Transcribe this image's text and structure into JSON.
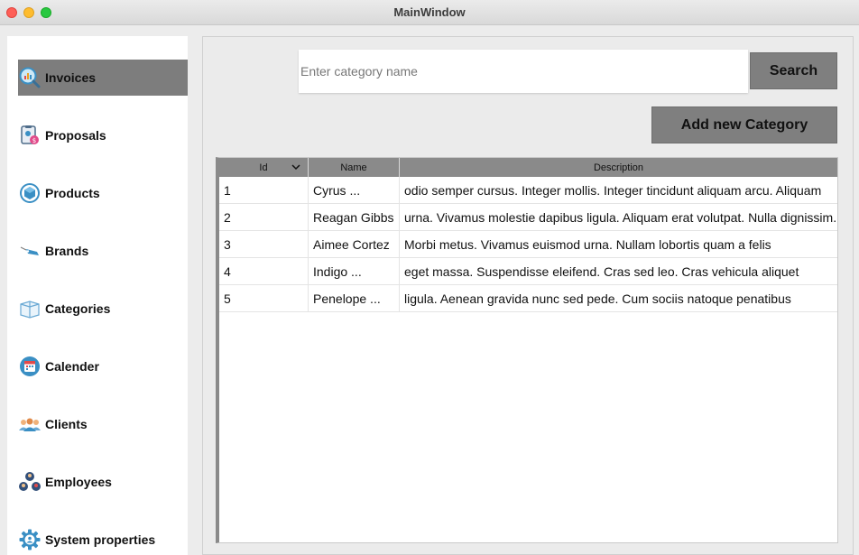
{
  "window": {
    "title": "MainWindow"
  },
  "sidebar": {
    "items": [
      {
        "label": "Invoices",
        "icon": "invoices-icon",
        "active": true
      },
      {
        "label": "Proposals",
        "icon": "proposals-icon",
        "active": false
      },
      {
        "label": "Products",
        "icon": "products-icon",
        "active": false
      },
      {
        "label": "Brands",
        "icon": "brands-icon",
        "active": false
      },
      {
        "label": "Categories",
        "icon": "categories-icon",
        "active": false
      },
      {
        "label": "Calender",
        "icon": "calendar-icon",
        "active": false
      },
      {
        "label": "Clients",
        "icon": "clients-icon",
        "active": false
      },
      {
        "label": "Employees",
        "icon": "employees-icon",
        "active": false
      },
      {
        "label": "System properties",
        "icon": "gear-icon",
        "active": false
      }
    ]
  },
  "search": {
    "placeholder": "Enter category name",
    "value": "",
    "button_label": "Search"
  },
  "actions": {
    "add_label": "Add new Category"
  },
  "table": {
    "headers": {
      "id": "Id",
      "name": "Name",
      "description": "Description"
    },
    "rows": [
      {
        "id": "1",
        "name": "Cyrus ...",
        "description": "odio semper cursus. Integer mollis. Integer tincidunt aliquam arcu. Aliquam"
      },
      {
        "id": "2",
        "name": "Reagan Gibbs",
        "description": "urna. Vivamus molestie dapibus ligula. Aliquam erat volutpat. Nulla dignissim."
      },
      {
        "id": "3",
        "name": "Aimee Cortez",
        "description": "Morbi metus. Vivamus euismod urna. Nullam lobortis quam a felis"
      },
      {
        "id": "4",
        "name": "Indigo ...",
        "description": "eget massa. Suspendisse eleifend. Cras sed leo. Cras vehicula aliquet"
      },
      {
        "id": "5",
        "name": "Penelope ...",
        "description": "ligula. Aenean gravida nunc sed pede. Cum sociis natoque penatibus"
      }
    ]
  },
  "colors": {
    "active_nav": "#7d7d7d",
    "button": "#7f7f7f",
    "header": "#8a8a8a"
  }
}
